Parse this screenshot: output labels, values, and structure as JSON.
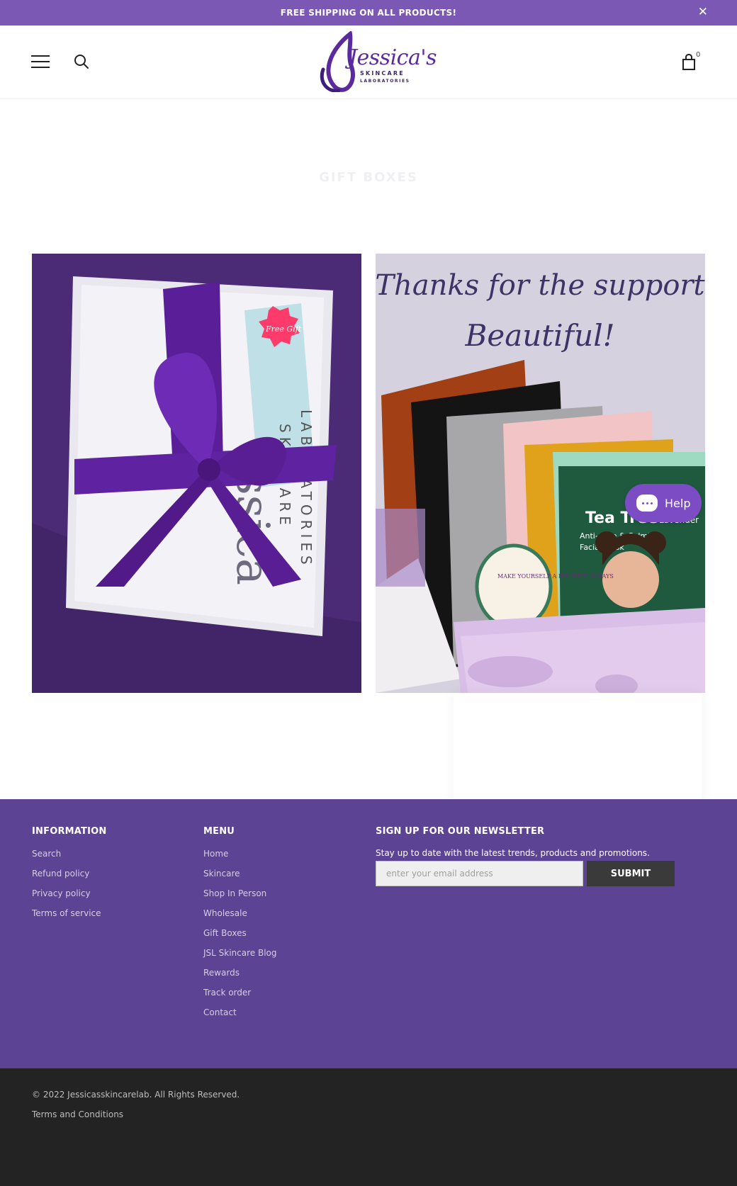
{
  "announcement": {
    "text": "FREE SHIPPING ON ALL PRODUCTS!",
    "close_icon": "close-icon"
  },
  "header": {
    "logo": {
      "word": "Jessica's",
      "line1": "SKINCARE",
      "line2": "LABORATORIES"
    },
    "cart_count": "0",
    "icons": [
      "menu-icon",
      "search-icon",
      "cart-icon"
    ]
  },
  "page": {
    "title": "GIFT BOXES"
  },
  "images": {
    "image1": {
      "badge_text": "Free Gift"
    },
    "image2": {
      "headline1": "Thanks for the support",
      "headline2": "Beautiful!",
      "mask_brand": "Tea Tree",
      "mask_sub": "Lavender",
      "mask_desc1": "Anti-acne & Calming",
      "mask_desc2": "Facial Mask",
      "sticker": "MAKE YOURSELF A PRIORITY ALWAYS"
    }
  },
  "help": {
    "label": "Help"
  },
  "footer": {
    "information": {
      "title": "INFORMATION",
      "items": [
        "Search",
        "Refund policy",
        "Privacy policy",
        "Terms of service"
      ]
    },
    "menu": {
      "title": "MENU",
      "items": [
        "Home",
        "Skincare",
        "Shop In Person",
        "Wholesale",
        "Gift Boxes",
        "JSL Skincare Blog",
        "Rewards",
        "Track order",
        "Contact"
      ]
    },
    "newsletter": {
      "title": "SIGN UP FOR OUR NEWSLETTER",
      "text": "Stay up to date with the latest trends, products and promotions.",
      "placeholder": "enter your email address",
      "button": "SUBMIT"
    }
  },
  "bottom": {
    "copyright": "© 2022 Jessicasskincarelab. All Rights Reserved.",
    "terms": "Terms and Conditions"
  },
  "colors": {
    "accent": "#7a58b4",
    "footer": "#5c4394",
    "bottom": "#232323",
    "help": "#7b4cc4"
  }
}
